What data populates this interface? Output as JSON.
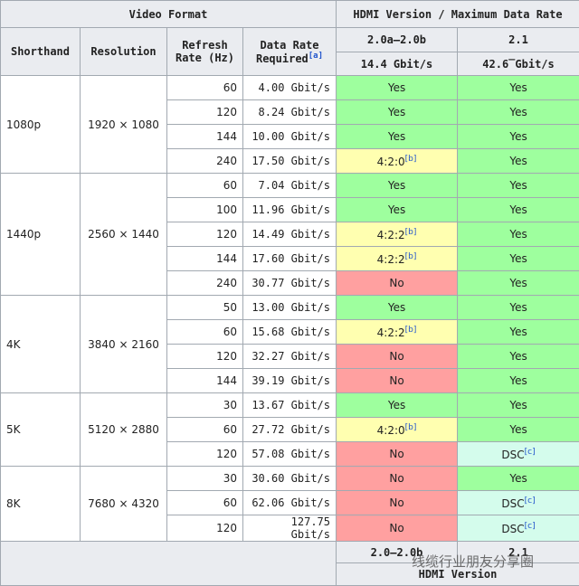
{
  "header": {
    "video_format": "Video Format",
    "hdmi_group": "HDMI Version / Maximum Data Rate",
    "col_shorthand": "Shorthand",
    "col_resolution": "Resolution",
    "col_refresh": "Refresh Rate (Hz)",
    "col_datarate": "Data Rate Required",
    "datarate_note": "[a]",
    "ver_a": "2.0a–2.0b",
    "ver_b": "2.1",
    "rate_a": "14.4 Gbit/s",
    "rate_b": "42.6̅ Gbit/s"
  },
  "groups": [
    {
      "shorthand": "1080p",
      "resolution": "1920 × 1080",
      "rows": [
        {
          "hz": "60",
          "rate": "4.00 Gbit/s",
          "a": "Yes",
          "a_note": "",
          "a_type": "yes",
          "b": "Yes",
          "b_note": "",
          "b_type": "yes"
        },
        {
          "hz": "120",
          "rate": "8.24 Gbit/s",
          "a": "Yes",
          "a_note": "",
          "a_type": "yes",
          "b": "Yes",
          "b_note": "",
          "b_type": "yes"
        },
        {
          "hz": "144",
          "rate": "10.00 Gbit/s",
          "a": "Yes",
          "a_note": "",
          "a_type": "yes",
          "b": "Yes",
          "b_note": "",
          "b_type": "yes"
        },
        {
          "hz": "240",
          "rate": "17.50 Gbit/s",
          "a": "4:2:0",
          "a_note": "[b]",
          "a_type": "partial",
          "b": "Yes",
          "b_note": "",
          "b_type": "yes"
        }
      ]
    },
    {
      "shorthand": "1440p",
      "resolution": "2560 × 1440",
      "rows": [
        {
          "hz": "60",
          "rate": "7.04 Gbit/s",
          "a": "Yes",
          "a_note": "",
          "a_type": "yes",
          "b": "Yes",
          "b_note": "",
          "b_type": "yes"
        },
        {
          "hz": "100",
          "rate": "11.96 Gbit/s",
          "a": "Yes",
          "a_note": "",
          "a_type": "yes",
          "b": "Yes",
          "b_note": "",
          "b_type": "yes"
        },
        {
          "hz": "120",
          "rate": "14.49 Gbit/s",
          "a": "4:2:2",
          "a_note": "[b]",
          "a_type": "partial",
          "b": "Yes",
          "b_note": "",
          "b_type": "yes"
        },
        {
          "hz": "144",
          "rate": "17.60 Gbit/s",
          "a": "4:2:2",
          "a_note": "[b]",
          "a_type": "partial",
          "b": "Yes",
          "b_note": "",
          "b_type": "yes"
        },
        {
          "hz": "240",
          "rate": "30.77 Gbit/s",
          "a": "No",
          "a_note": "",
          "a_type": "no",
          "b": "Yes",
          "b_note": "",
          "b_type": "yes"
        }
      ]
    },
    {
      "shorthand": "4K",
      "resolution": "3840 × 2160",
      "rows": [
        {
          "hz": "50",
          "rate": "13.00 Gbit/s",
          "a": "Yes",
          "a_note": "",
          "a_type": "yes",
          "b": "Yes",
          "b_note": "",
          "b_type": "yes"
        },
        {
          "hz": "60",
          "rate": "15.68 Gbit/s",
          "a": "4:2:2",
          "a_note": "[b]",
          "a_type": "partial",
          "b": "Yes",
          "b_note": "",
          "b_type": "yes"
        },
        {
          "hz": "120",
          "rate": "32.27 Gbit/s",
          "a": "No",
          "a_note": "",
          "a_type": "no",
          "b": "Yes",
          "b_note": "",
          "b_type": "yes"
        },
        {
          "hz": "144",
          "rate": "39.19 Gbit/s",
          "a": "No",
          "a_note": "",
          "a_type": "no",
          "b": "Yes",
          "b_note": "",
          "b_type": "yes"
        }
      ]
    },
    {
      "shorthand": "5K",
      "resolution": "5120 × 2880",
      "rows": [
        {
          "hz": "30",
          "rate": "13.67 Gbit/s",
          "a": "Yes",
          "a_note": "",
          "a_type": "yes",
          "b": "Yes",
          "b_note": "",
          "b_type": "yes"
        },
        {
          "hz": "60",
          "rate": "27.72 Gbit/s",
          "a": "4:2:0",
          "a_note": "[b]",
          "a_type": "partial",
          "b": "Yes",
          "b_note": "",
          "b_type": "yes"
        },
        {
          "hz": "120",
          "rate": "57.08 Gbit/s",
          "a": "No",
          "a_note": "",
          "a_type": "no",
          "b": "DSC",
          "b_note": "[c]",
          "b_type": "dsc"
        }
      ]
    },
    {
      "shorthand": "8K",
      "resolution": "7680 × 4320",
      "rows": [
        {
          "hz": "30",
          "rate": "30.60 Gbit/s",
          "a": "No",
          "a_note": "",
          "a_type": "no",
          "b": "Yes",
          "b_note": "",
          "b_type": "yes"
        },
        {
          "hz": "60",
          "rate": "62.06 Gbit/s",
          "a": "No",
          "a_note": "",
          "a_type": "no",
          "b": "DSC",
          "b_note": "[c]",
          "b_type": "dsc"
        },
        {
          "hz": "120",
          "rate": "127.75 Gbit/s",
          "a": "No",
          "a_note": "",
          "a_type": "no",
          "b": "DSC",
          "b_note": "[c]",
          "b_type": "dsc"
        }
      ]
    }
  ],
  "footer": {
    "ver_a": "2.0–2.0b",
    "ver_b": "2.1",
    "label": "HDMI Version"
  },
  "watermark": "线缆行业朋友分享圈",
  "colors": {
    "yes": "#9eff9e",
    "no": "#ffa0a0",
    "partial": "#ffffb0",
    "dsc": "#d4fcec",
    "header": "#eaecf0"
  }
}
